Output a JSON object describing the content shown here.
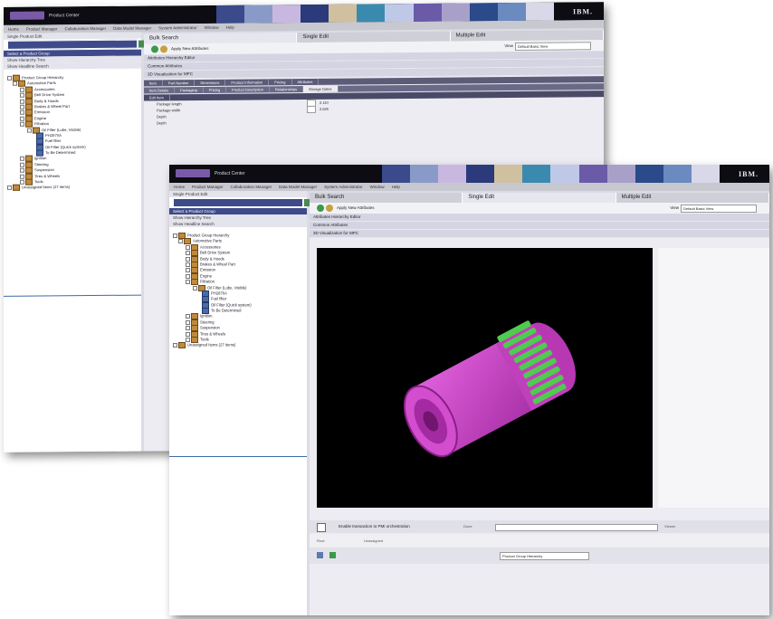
{
  "app": {
    "product": "Product Center",
    "vendor": "IBM."
  },
  "menu": [
    "Home",
    "Product Manager",
    "Collaboration Manager",
    "Data Model Manager",
    "System Administrator",
    "Window",
    "Help"
  ],
  "left_panel": {
    "header": "Single Product Edit",
    "row1": "Select a Product Group",
    "row2": "Show Hierarchy Tree",
    "row3": "Show Headline Search",
    "tree": [
      {
        "label": "Product Group Hierarchy",
        "level": 0
      },
      {
        "label": "Automotive Parts",
        "level": 1
      },
      {
        "label": "Accessories",
        "level": 2
      },
      {
        "label": "Belt Drive System",
        "level": 2
      },
      {
        "label": "Body & Hoods",
        "level": 2
      },
      {
        "label": "Brakes & Wheel Part",
        "level": 2
      },
      {
        "label": "Emission",
        "level": 2
      },
      {
        "label": "Engine",
        "level": 2
      },
      {
        "label": "Filtration",
        "level": 2
      },
      {
        "label": "Oil Filter (Lube, Visible)",
        "level": 3
      },
      {
        "label": "PH2870A",
        "level": 4,
        "leaf": true
      },
      {
        "label": "Fuel filter",
        "level": 4,
        "leaf": true
      },
      {
        "label": "Oil Filter (Quick system)",
        "level": 4,
        "leaf": true
      },
      {
        "label": "To Be Determined",
        "level": 4,
        "leaf": true
      },
      {
        "label": "Ignition",
        "level": 2
      },
      {
        "label": "Steering",
        "level": 2
      },
      {
        "label": "Suspension",
        "level": 2
      },
      {
        "label": "Tires & Wheels",
        "level": 2
      },
      {
        "label": "Tools",
        "level": 2
      },
      {
        "label": "Unassigned Items (27 items)",
        "level": 0
      }
    ]
  },
  "tabs": [
    "Bulk Search",
    "Single Edit",
    "Multiple Edit"
  ],
  "toolbar": {
    "label": "Apply New Attributes",
    "view_label": "View",
    "view_value": "Default Basic View"
  },
  "sections": [
    "Attributes Hierarchy Editor",
    "Common Attributes",
    "3D Visualization for MPC"
  ],
  "back_tabs1": [
    "Item",
    "Part Number",
    "Dimensions",
    "Product Information",
    "Pricing",
    "Attributes"
  ],
  "back_tabs2": [
    "Item Details",
    "Packaging",
    "Pricing",
    "Product Description",
    "Relationships",
    "Storage Dates"
  ],
  "back_sub": "Edit Item",
  "fields": [
    {
      "label": "Package length",
      "value": "2.110"
    },
    {
      "label": "Package width",
      "value": "2.625"
    },
    {
      "label": "Depth",
      "value": ""
    },
    {
      "label": "Depth",
      "value": ""
    }
  ],
  "status": {
    "text": "Enable transaction to PMI orchestration",
    "done": "Done",
    "right": "Viewer"
  },
  "bottom": {
    "left": "Root",
    "dropdown": "Product Group Hierarchy",
    "extra": "Unassigned"
  },
  "colors": {
    "body": "#c43fc0",
    "teeth": "#4fcc4f",
    "viewer_bg": "#000000",
    "accent": "#3e4a8a"
  }
}
